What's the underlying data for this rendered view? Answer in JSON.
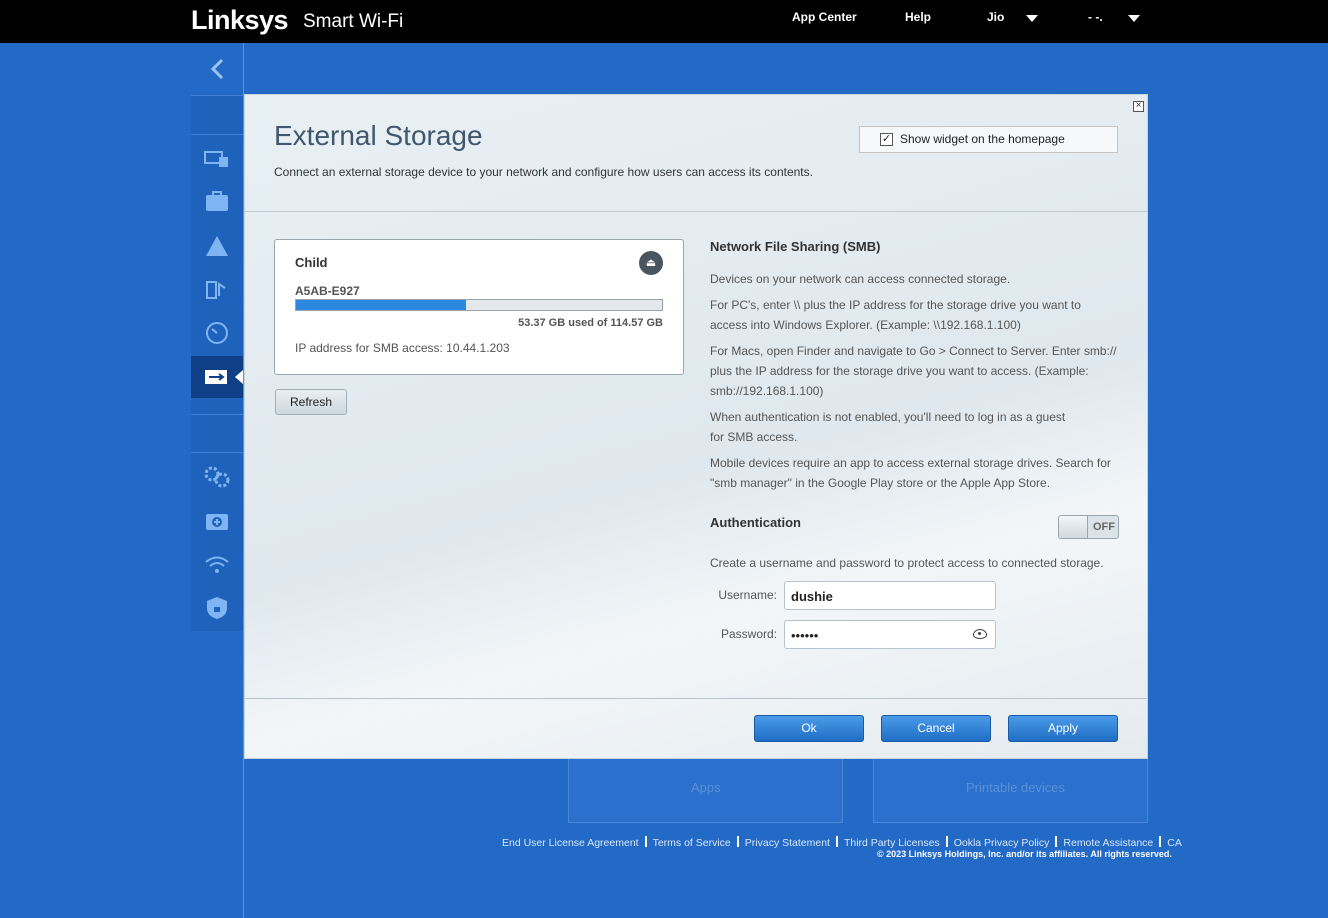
{
  "header": {
    "logo": "Linksys",
    "app_name": "Smart Wi-Fi",
    "nav": {
      "app_center": "App Center",
      "help": "Help",
      "user": "Jio",
      "account": "- -."
    }
  },
  "sidebar": {
    "items": [
      {
        "icon": "devices-icon"
      },
      {
        "icon": "parental-controls-icon"
      },
      {
        "icon": "guest-access-icon"
      },
      {
        "icon": "prioritization-icon"
      },
      {
        "icon": "speed-test-icon"
      },
      {
        "icon": "usb-storage-icon",
        "active": true
      },
      {
        "icon": "connectivity-icon"
      },
      {
        "icon": "troubleshooting-icon"
      },
      {
        "icon": "wireless-icon"
      },
      {
        "icon": "security-icon"
      }
    ]
  },
  "modal": {
    "title": "External Storage",
    "description": "Connect an external storage device to your network and configure how users can access its contents.",
    "widget_checkbox_label": "Show widget on the homepage",
    "widget_checked": true,
    "device": {
      "name": "Child",
      "id": "A5AB-E927",
      "used_gb": 53.37,
      "total_gb": 114.57,
      "usage_text": "53.37 GB used of 114.57 GB",
      "ip_label": "IP address for SMB access: 10.44.1.203"
    },
    "refresh_label": "Refresh",
    "smb": {
      "title": "Network File Sharing (SMB)",
      "p1": "Devices on your network can access connected storage.",
      "p2": "For PC's, enter \\\\ plus the IP address for the storage drive you want to access into Windows Explorer. (Example: \\\\192.168.1.100)",
      "p3": "For Macs, open Finder and navigate to Go > Connect to Server. Enter smb:// plus the IP address for the storage drive you want to access. (Example: smb://192.168.1.100)",
      "p4": "When authentication is not enabled, you'll need to log in as a guest for SMB access.",
      "p5": "Mobile devices require an app to access external storage drives. Search for \"smb manager\" in the Google Play store or the Apple App Store."
    },
    "auth": {
      "title": "Authentication",
      "toggle_state": "OFF",
      "description": "Create a username and password to protect access to connected storage.",
      "username_label": "Username:",
      "username_value": "dushie",
      "password_label": "Password:",
      "password_value": "••••••"
    },
    "buttons": {
      "ok": "Ok",
      "cancel": "Cancel",
      "apply": "Apply"
    }
  },
  "background_cards": {
    "apps": "Apps",
    "printer_devices": "Printable devices"
  },
  "footer": {
    "links": [
      "End User License Agreement",
      "Terms of Service",
      "Privacy Statement",
      "Third Party Licenses",
      "Ookla Privacy Policy",
      "Remote Assistance",
      "CA"
    ],
    "copyright": "© 2023 Linksys Holdings, Inc. and/or its affiliates. All rights reserved."
  },
  "colors": {
    "page_bg": "#2369c6",
    "accent_blue": "#2b87e0",
    "sidebar_active": "#0f3f86"
  }
}
